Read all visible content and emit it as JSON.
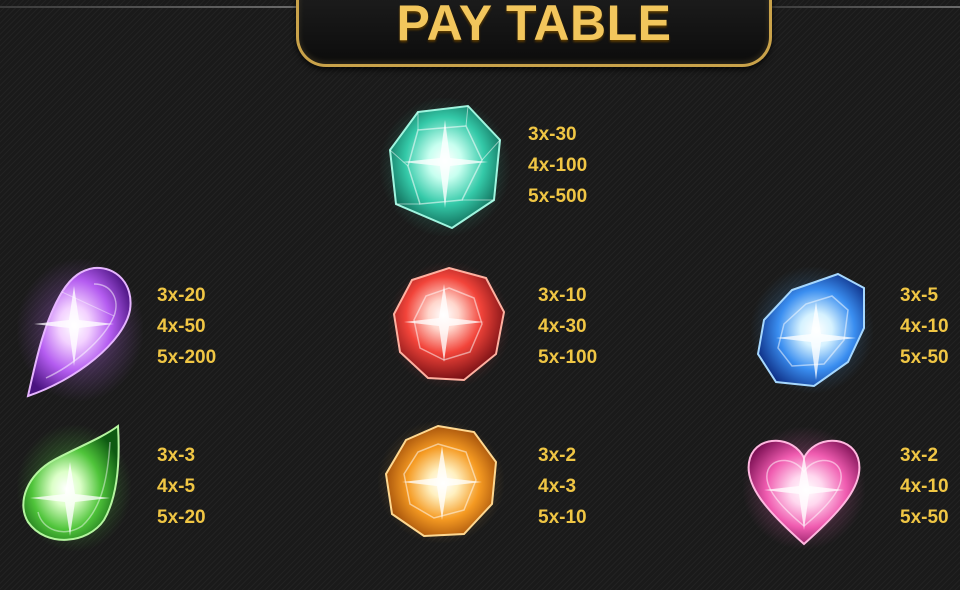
{
  "title": "PAY TABLE",
  "colors": {
    "gold_text": "#f0c644",
    "title_gold": "#f2c65c",
    "plate_border": "#c9a24a",
    "background": "#1a1a1a"
  },
  "symbols": [
    {
      "icon": "teal-emerald-gem-icon",
      "pays": [
        "3x-30",
        "4x-100",
        "5x-500"
      ]
    },
    {
      "icon": "purple-teardrop-gem-icon",
      "pays": [
        "3x-20",
        "4x-50",
        "5x-200"
      ]
    },
    {
      "icon": "red-round-gem-icon",
      "pays": [
        "3x-10",
        "4x-30",
        "5x-100"
      ]
    },
    {
      "icon": "blue-oval-gem-icon",
      "pays": [
        "3x-5",
        "4x-10",
        "5x-50"
      ]
    },
    {
      "icon": "green-teardrop-gem-icon",
      "pays": [
        "3x-3",
        "4x-5",
        "5x-20"
      ]
    },
    {
      "icon": "orange-round-gem-icon",
      "pays": [
        "3x-2",
        "4x-3",
        "5x-10"
      ]
    },
    {
      "icon": "pink-heart-gem-icon",
      "pays": [
        "3x-2",
        "4x-10",
        "5x-50"
      ]
    }
  ]
}
